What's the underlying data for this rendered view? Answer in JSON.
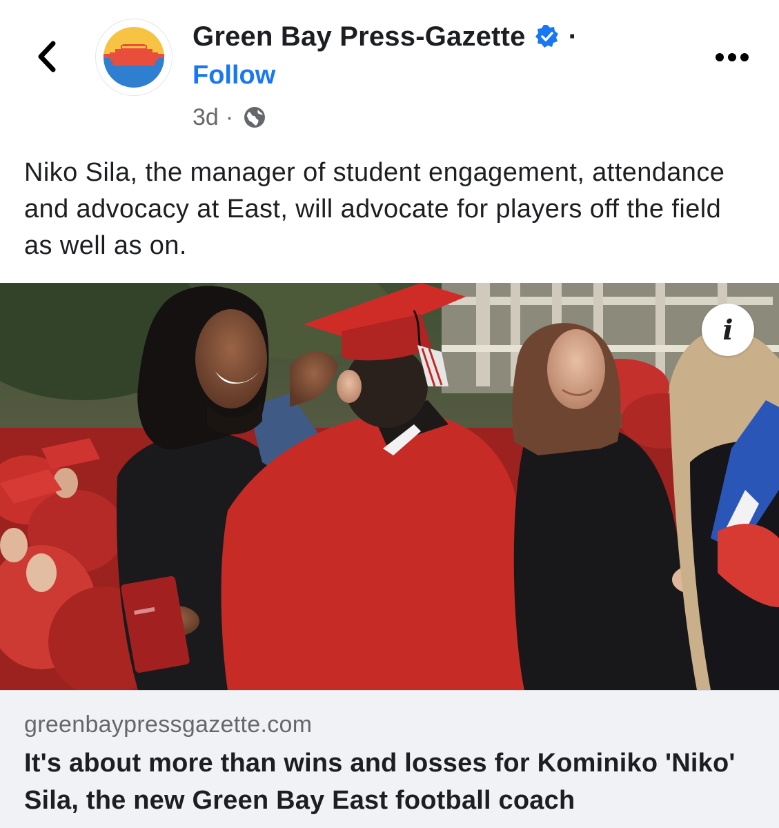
{
  "header": {
    "page_name": "Green Bay Press-Gazette",
    "separator": "·",
    "follow_label": "Follow",
    "timestamp": "3d",
    "meta_separator": "·",
    "back_icon": "chevron-left-icon",
    "verified_icon": "verified-badge-icon",
    "privacy_icon": "globe-icon",
    "more_icon": "more-horizontal-icon",
    "avatar_icon": "stadium-logo-icon"
  },
  "post": {
    "text": "Niko Sila, the manager of student engagement, attendance and advocacy at East, will advocate for players off the field as well as on.",
    "info_label": "i"
  },
  "link_preview": {
    "domain": "greenbaypressgazette.com",
    "title": "It's about more than wins and losses for Kominiko 'Niko' Sila, the new Green Bay East football coach"
  },
  "colors": {
    "accent": "#1877f2",
    "text": "#1c1e21",
    "secondary_text": "#65676b",
    "preview_background": "#f0f2f5"
  }
}
